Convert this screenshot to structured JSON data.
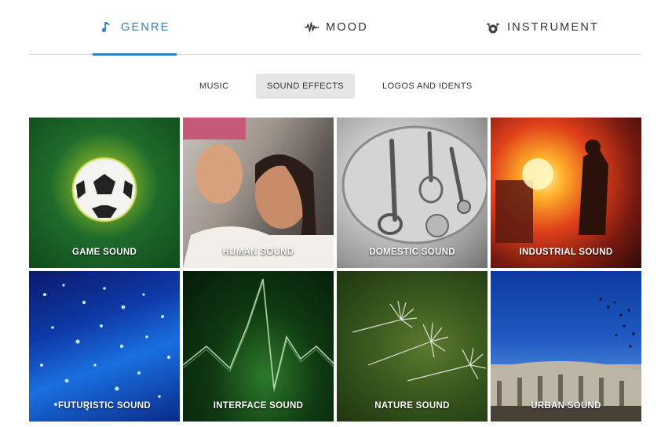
{
  "top_tabs": {
    "genre": {
      "label": "GENRE",
      "icon": "music-note-icon"
    },
    "mood": {
      "label": "MOOD",
      "icon": "waveform-icon"
    },
    "instrument": {
      "label": "INSTRUMENT",
      "icon": "drum-icon"
    },
    "active": "genre",
    "accent_color": "#2f7fc1"
  },
  "sub_tabs": {
    "music": "MUSIC",
    "sound_effects": "SOUND EFFECTS",
    "logos": "LOGOS AND IDENTS",
    "active": "sound_effects"
  },
  "tiles": [
    {
      "label": "GAME SOUND"
    },
    {
      "label": "HUMAN SOUND"
    },
    {
      "label": "DOMESTIC SOUND"
    },
    {
      "label": "INDUSTRIAL SOUND"
    },
    {
      "label": "FUTURISTIC SOUND"
    },
    {
      "label": "INTERFACE SOUND"
    },
    {
      "label": "NATURE SOUND"
    },
    {
      "label": "URBAN SOUND"
    }
  ]
}
